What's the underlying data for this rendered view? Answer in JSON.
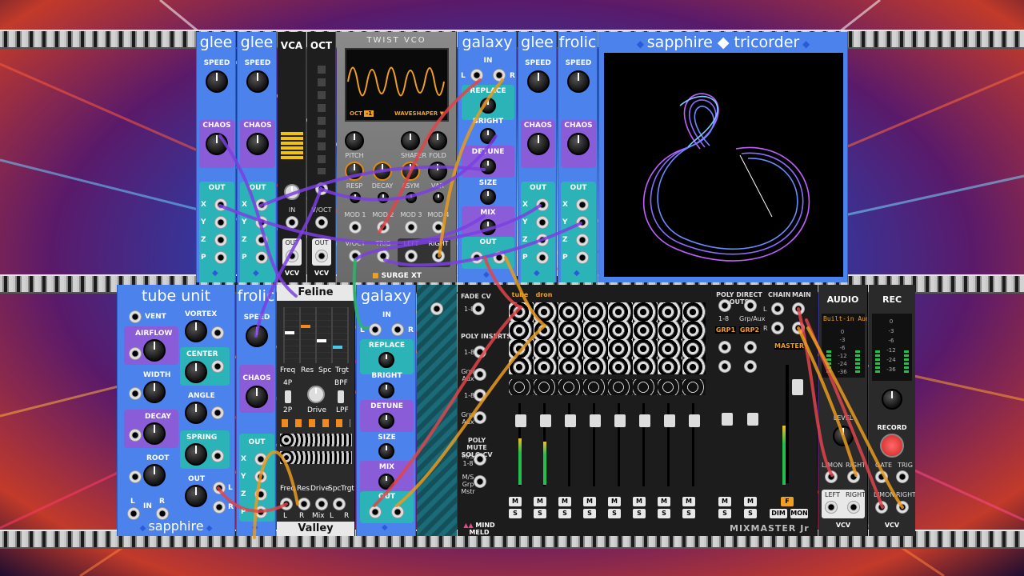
{
  "colors": {
    "panel_blue": "#4b82ec",
    "purple": "#8a5cd8",
    "teal": "#2bb3b8",
    "cable_purple": "#7b3fe0",
    "cable_orange": "#e89a1e",
    "cable_red": "#e0444a",
    "cable_green": "#2db56a"
  },
  "rack": {
    "row1": {
      "glee1": {
        "title": "glee",
        "speed": "SPEED",
        "chaos": "CHAOS",
        "out": "OUT",
        "x": "X",
        "y": "Y",
        "z": "Z",
        "p": "P"
      },
      "glee2": {
        "title": "glee",
        "speed": "SPEED",
        "chaos": "CHAOS",
        "out": "OUT",
        "x": "X",
        "y": "Y",
        "z": "Z",
        "p": "P"
      },
      "vca": {
        "title": "VCA",
        "in": "IN",
        "out": "OUT",
        "brand": "VCV"
      },
      "oct": {
        "title": "OCT",
        "voct": "V/OCT",
        "out": "OUT",
        "brand": "VCV"
      },
      "twist": {
        "title": "TWIST VCO",
        "oct_label": "OCT",
        "oct_value": "-1",
        "waveshaper": "WAVESHAPER",
        "pitch": "PITCH",
        "shaper": "SHAPER",
        "fold": "FOLD",
        "resp": "RESP",
        "decay": "DECAY",
        "asym": "ASYM",
        "var": "VAR",
        "mod1": "MOD 1",
        "mod2": "MOD 2",
        "mod3": "MOD 3",
        "mod4": "MOD 4",
        "voct": "V/OCT",
        "trig": "TRIG",
        "left": "LEFT",
        "right": "RIGHT",
        "brand": "SURGE XT"
      },
      "galaxy1": {
        "title": "galaxy",
        "in": "IN",
        "l": "L",
        "r": "R",
        "replace": "REPLACE",
        "bright": "BRIGHT",
        "detune": "DETUNE",
        "size": "SIZE",
        "mix": "MIX",
        "out": "OUT"
      },
      "glee3": {
        "title": "glee",
        "speed": "SPEED",
        "chaos": "CHAOS",
        "out": "OUT",
        "x": "X",
        "y": "Y",
        "z": "Z",
        "p": "P"
      },
      "frolic1": {
        "title": "frolic",
        "speed": "SPEED",
        "chaos": "CHAOS",
        "out": "OUT",
        "x": "X",
        "y": "Y",
        "z": "Z",
        "p": "P"
      },
      "tricorder": {
        "title": "sapphire ◆ tricorder"
      }
    },
    "row2": {
      "tubeunit": {
        "title": "tube unit",
        "vent": "VENT",
        "vortex": "VORTEX",
        "airflow": "AIRFLOW",
        "center": "CENTER",
        "width": "WIDTH",
        "angle": "ANGLE",
        "decay": "DECAY",
        "spring": "SPRING",
        "root": "ROOT",
        "out": "OUT",
        "l": "L",
        "in": "IN",
        "r": "R",
        "footer": "sapphire"
      },
      "frolic2": {
        "title": "frolic",
        "speed": "SPEED",
        "chaos": "CHAOS",
        "out": "OUT",
        "x": "X",
        "y": "Y",
        "z": "Z",
        "p": "P"
      },
      "feline": {
        "title": "Feline",
        "freq": "Freq",
        "res": "Res",
        "spc": "Spc",
        "trgt": "Trgt",
        "p4": "4P",
        "bpf": "BPF",
        "p2": "2P",
        "drive": "Drive",
        "lpf": "LPF",
        "jfreq": "Freq",
        "jres": "Res",
        "jdrive": "Drive",
        "jspc": "Spc",
        "jtrgt": "Trgt",
        "l": "L",
        "r": "R",
        "mix": "Mix",
        "l2": "L",
        "r2": "R",
        "footer": "Valley"
      },
      "galaxy2": {
        "title": "galaxy",
        "in": "IN",
        "l": "L",
        "r": "R",
        "replace": "REPLACE",
        "bright": "BRIGHT",
        "detune": "DETUNE",
        "size": "SIZE",
        "mix": "MIX",
        "out": "OUT"
      },
      "mixmaster": {
        "fade_cv": "FADE CV",
        "fade_18": "1-8",
        "poly_inserts": "POLY INSERTS",
        "pi_18": "1-8",
        "grp_aux": "Grp/ Aux",
        "p18": "1-8",
        "grp_aux2": "Grp/ Aux",
        "poly_mute": "POLY MUTE SOLO CV",
        "ms18": "M/S 1-8",
        "ms_grp": "M/S Grp Mstr",
        "track1": "tube",
        "track2": "dron",
        "poly_direct": "POLY DIRECT OUTS",
        "pd_18": "1-8",
        "pd_grp": "Grp/Aux",
        "grp1": "GRP1",
        "grp2": "GRP2",
        "chain": "CHAIN",
        "main": "MAIN",
        "master": "MASTER",
        "l": "L",
        "r": "R",
        "m": "M",
        "s": "S",
        "f": "F",
        "dim": "DIM",
        "mon": "MON",
        "brand": "MIND MELD",
        "footer": "MIXMASTER Jr"
      },
      "audio": {
        "title": "AUDIO",
        "device": "Built-in Aud",
        "meter_labels": [
          "0",
          "-3",
          "-6",
          "-12",
          "-24",
          "-36"
        ],
        "level": "LEVEL",
        "lmon": "L/MON",
        "right": "RIGHT",
        "left": "LEFT",
        "right2": "RIGHT",
        "brand": "VCV"
      },
      "rec": {
        "title": "REC",
        "meter_labels": [
          "0",
          "-3",
          "-6",
          "-12",
          "-24",
          "-36"
        ],
        "record": "RECORD",
        "gate": "GATE",
        "trig": "TRIG",
        "lmon": "L/MON",
        "right": "RIGHT",
        "brand": "VCV"
      }
    }
  }
}
